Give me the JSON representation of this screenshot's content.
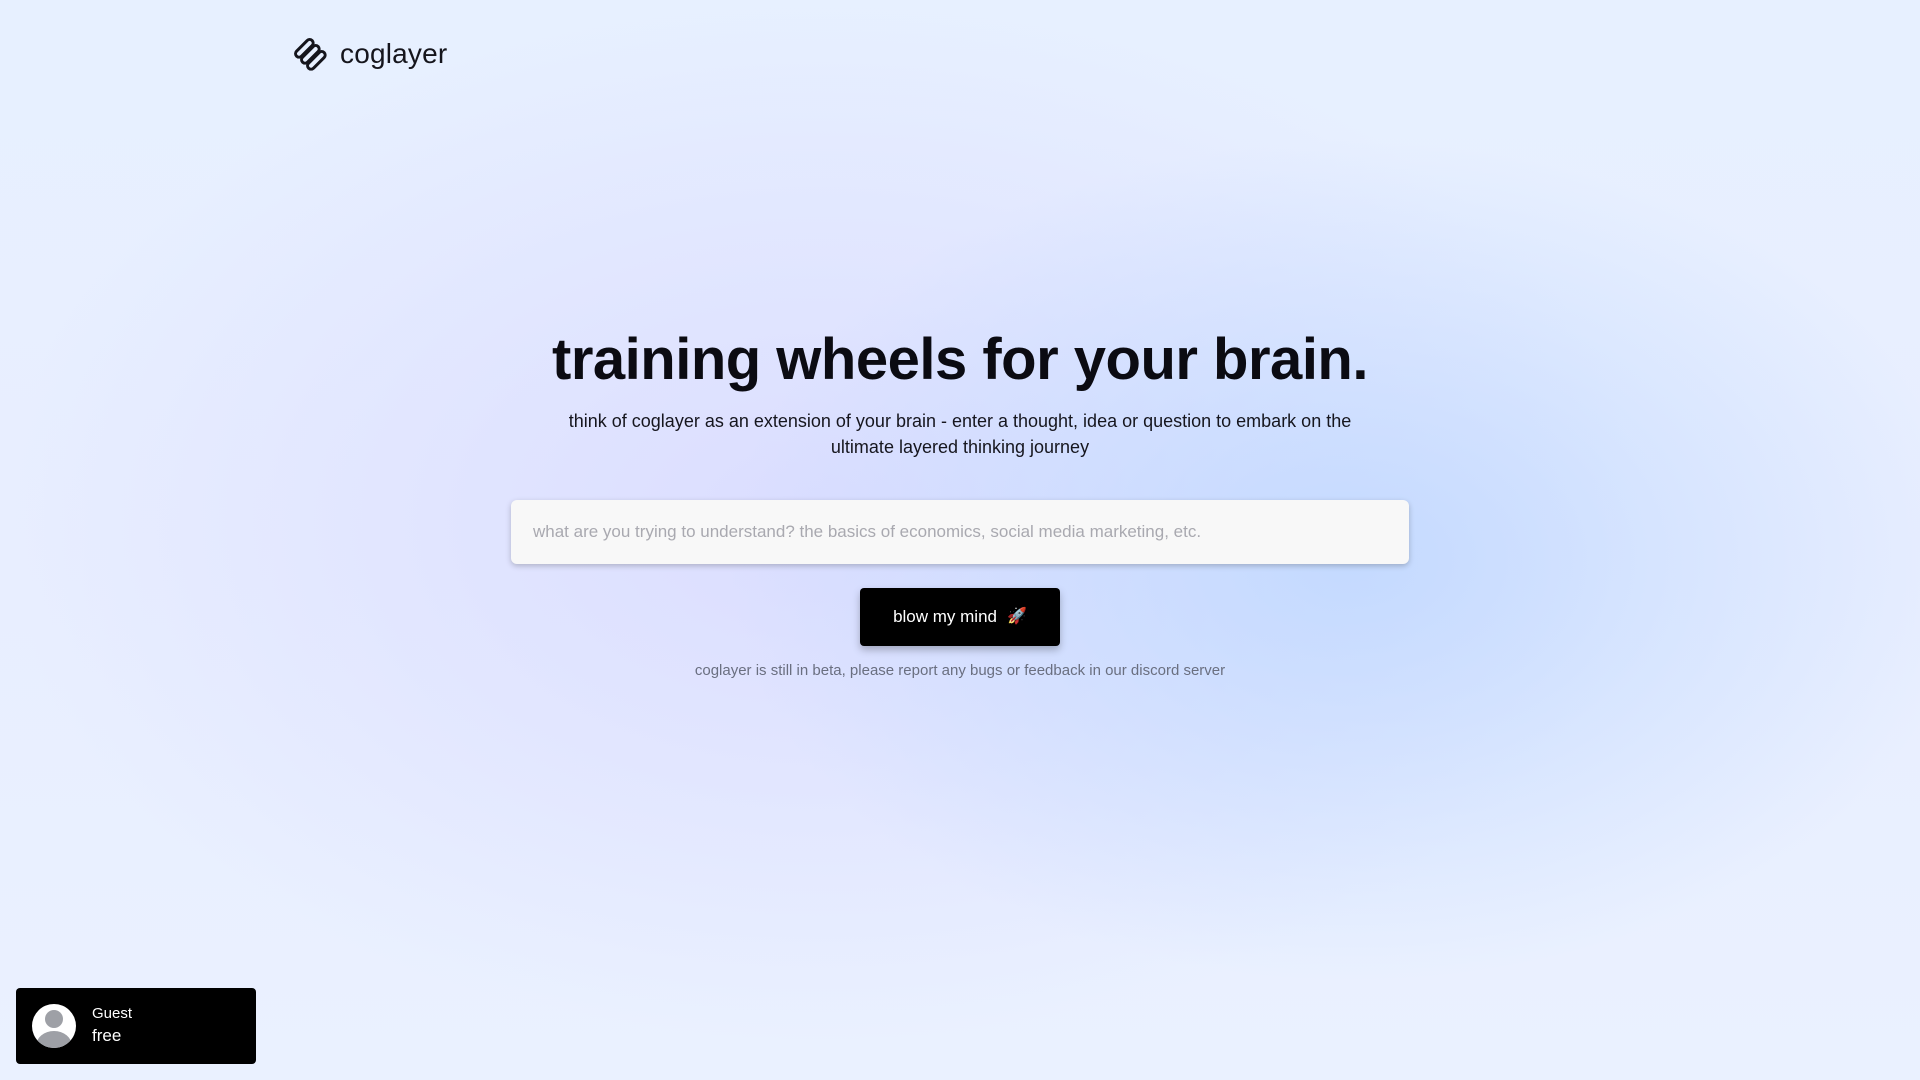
{
  "brand": {
    "name": "coglayer",
    "icon": "coglayer-logo-icon"
  },
  "hero": {
    "headline": "training wheels for your brain.",
    "subtitle": "think of coglayer as an extension of your brain - enter a thought, idea or question to embark on the ultimate layered thinking journey"
  },
  "search": {
    "placeholder": "what are you trying to understand? the basics of economics, social media marketing, etc.",
    "value": ""
  },
  "cta": {
    "label": "blow my mind",
    "icon": "rocket-icon",
    "icon_glyph": "🚀"
  },
  "beta_note": "coglayer is still in beta, please report any bugs or feedback in our discord server",
  "user": {
    "name": "Guest",
    "plan": "free",
    "avatar_icon": "user-avatar-icon"
  },
  "colors": {
    "button_bg": "#000000",
    "button_text": "#ffffff",
    "text_primary": "#0b0b12",
    "text_muted": "#6a6f80",
    "input_bg": "#f8f8f8"
  }
}
